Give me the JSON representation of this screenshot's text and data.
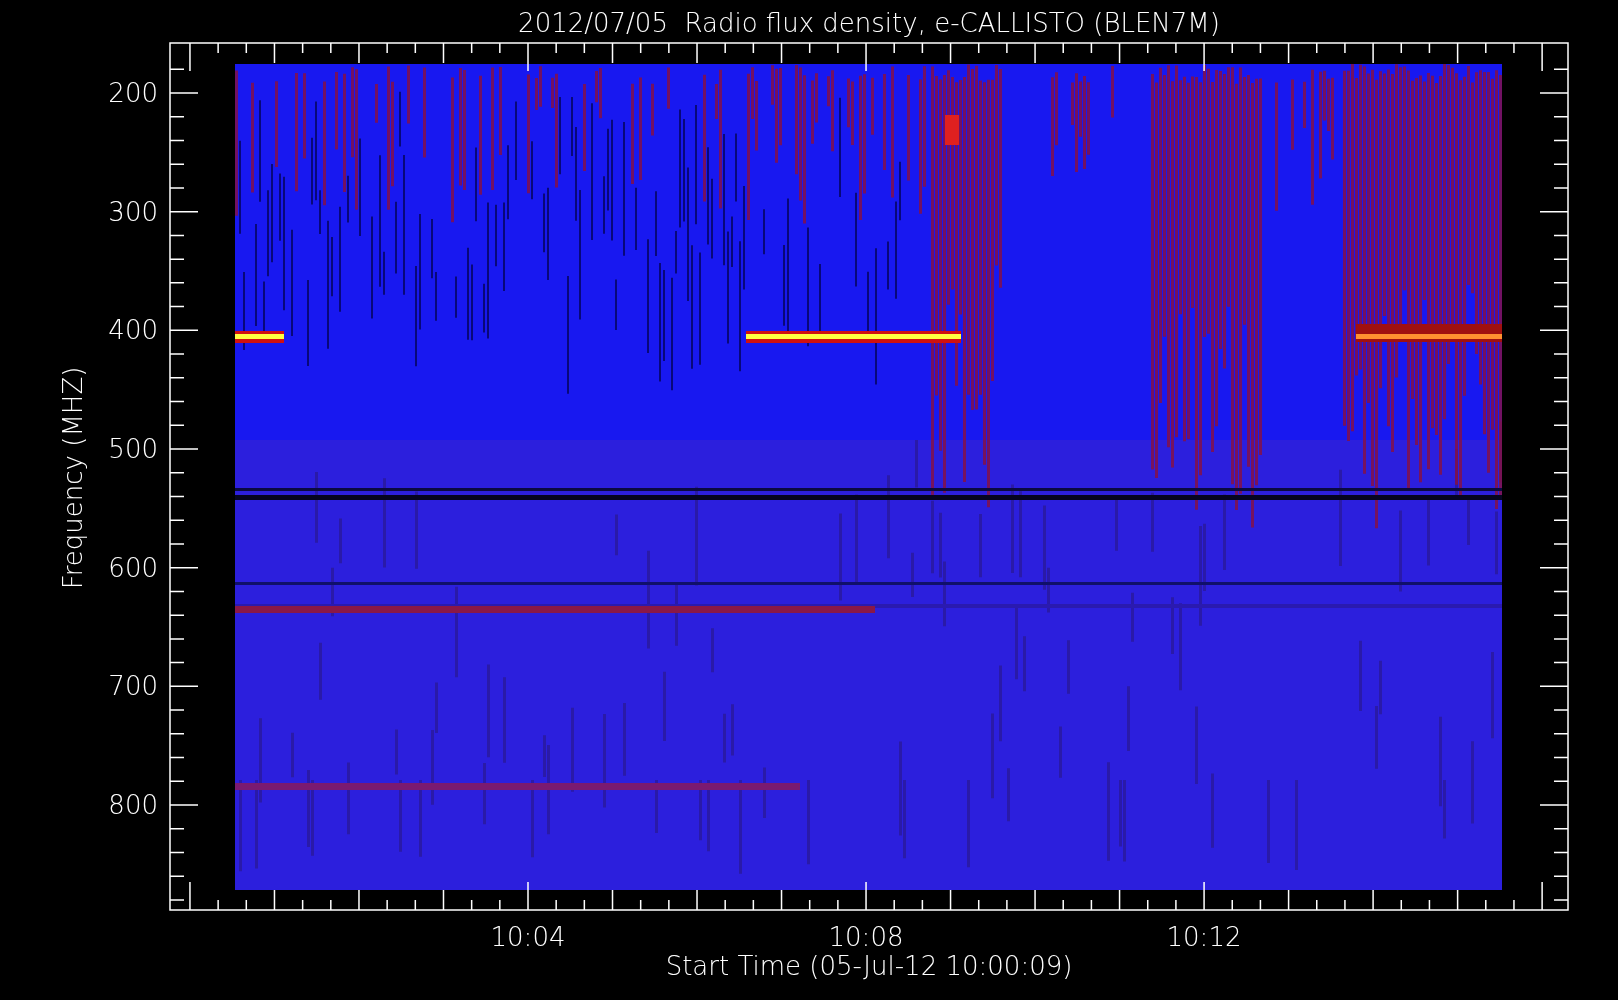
{
  "title": "2012/07/05  Radio flux density, e-CALLISTO (BLEN7M)",
  "y_axis": {
    "label": "Frequency (MHZ)",
    "ticks": [
      "200",
      "300",
      "400",
      "500",
      "600",
      "700",
      "800"
    ]
  },
  "x_axis": {
    "label": "Start Time (05-Jul-12 10:00:09)",
    "ticks": [
      "10:04",
      "10:08",
      "10:12"
    ]
  }
}
